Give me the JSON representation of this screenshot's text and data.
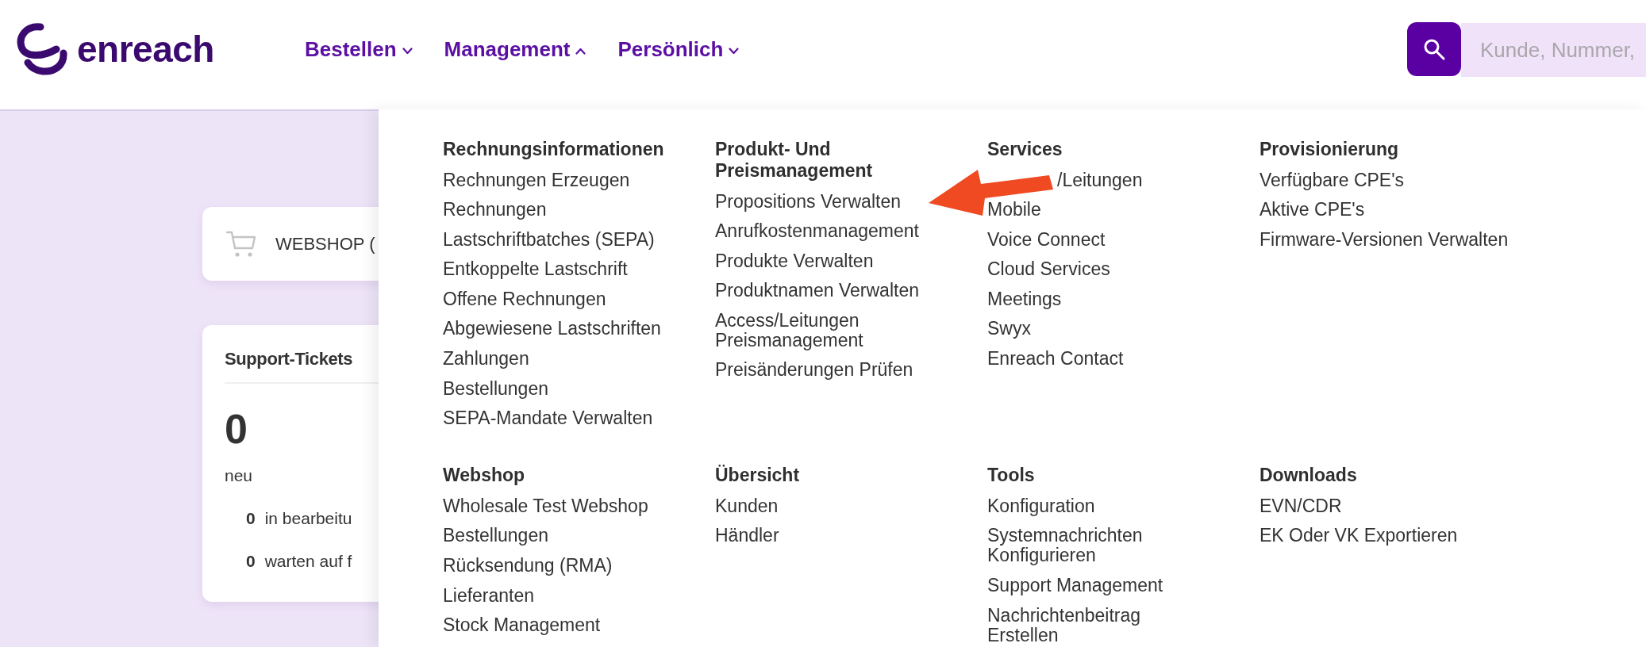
{
  "header": {
    "logo": {
      "text": "enreach"
    },
    "nav": [
      {
        "label": "Bestellen",
        "expanded": false
      },
      {
        "label": "Management",
        "expanded": true
      },
      {
        "label": "Persönlich",
        "expanded": false
      }
    ],
    "search": {
      "placeholder": "Kunde, Nummer,"
    }
  },
  "dashboard": {
    "webshop_card": {
      "label": "WEBSHOP ("
    },
    "support_tickets": {
      "title": "Support-Tickets",
      "count": "0",
      "count_label": "neu",
      "rows": [
        {
          "count": "0",
          "label": "in bearbeitu"
        },
        {
          "count": "0",
          "label": "warten auf f"
        }
      ]
    }
  },
  "mega_menu": {
    "sections": [
      {
        "title": "Rechnungsinformationen",
        "items": [
          {
            "label": "Rechnungen Erzeugen"
          },
          {
            "label": "Rechnungen"
          },
          {
            "label": "Lastschriftbatches (SEPA)"
          },
          {
            "label": "Entkoppelte Lastschrift"
          },
          {
            "label": "Offene Rechnungen"
          },
          {
            "label": "Abgewiesene Lastschriften"
          },
          {
            "label": "Zahlungen"
          },
          {
            "label": "Bestellungen"
          },
          {
            "label": "SEPA-Mandate Verwalten"
          }
        ]
      },
      {
        "title": "Produkt- Und Preismanagement",
        "items": [
          {
            "label": "Propositions Verwalten"
          },
          {
            "label": "Anrufkostenmanagement"
          },
          {
            "label": "Produkte Verwalten"
          },
          {
            "label": "Produktnamen Verwalten"
          },
          {
            "label": "Access/Leitungen Preismanagement"
          },
          {
            "label": "Preisänderungen Prüfen"
          }
        ]
      },
      {
        "title": "Services",
        "items": [
          {
            "label": "/Leitungen",
            "kind": "covered"
          },
          {
            "label": "Mobile",
            "kind": "link"
          },
          {
            "label": "Voice Connect",
            "kind": "link"
          },
          {
            "label": "Cloud Services",
            "kind": "link"
          },
          {
            "label": "Meetings",
            "kind": "link"
          },
          {
            "label": "Swyx",
            "kind": "link"
          },
          {
            "label": "Enreach Contact",
            "kind": "link"
          }
        ]
      },
      {
        "title": "Provisionierung",
        "items": [
          {
            "label": "Verfügbare CPE's"
          },
          {
            "label": "Aktive CPE's"
          },
          {
            "label": "Firmware-Versionen Verwalten"
          }
        ]
      },
      {
        "title": "Webshop",
        "items": [
          {
            "label": "Wholesale Test Webshop"
          },
          {
            "label": "Bestellungen"
          },
          {
            "label": "Rücksendung (RMA)"
          },
          {
            "label": "Lieferanten"
          },
          {
            "label": "Stock Management"
          }
        ]
      },
      {
        "title": "Übersicht",
        "items": [
          {
            "label": "Kunden"
          },
          {
            "label": "Händler"
          }
        ]
      },
      {
        "title": "Tools",
        "items": [
          {
            "label": "Konfiguration"
          },
          {
            "label": "Systemnachrichten Konfigurieren"
          },
          {
            "label": "Support Management"
          },
          {
            "label": "Nachrichtenbeitrag Erstellen"
          }
        ]
      },
      {
        "title": "Downloads",
        "items": [
          {
            "label": "EVN/CDR"
          },
          {
            "label": "EK Oder VK Exportieren"
          }
        ]
      }
    ]
  }
}
